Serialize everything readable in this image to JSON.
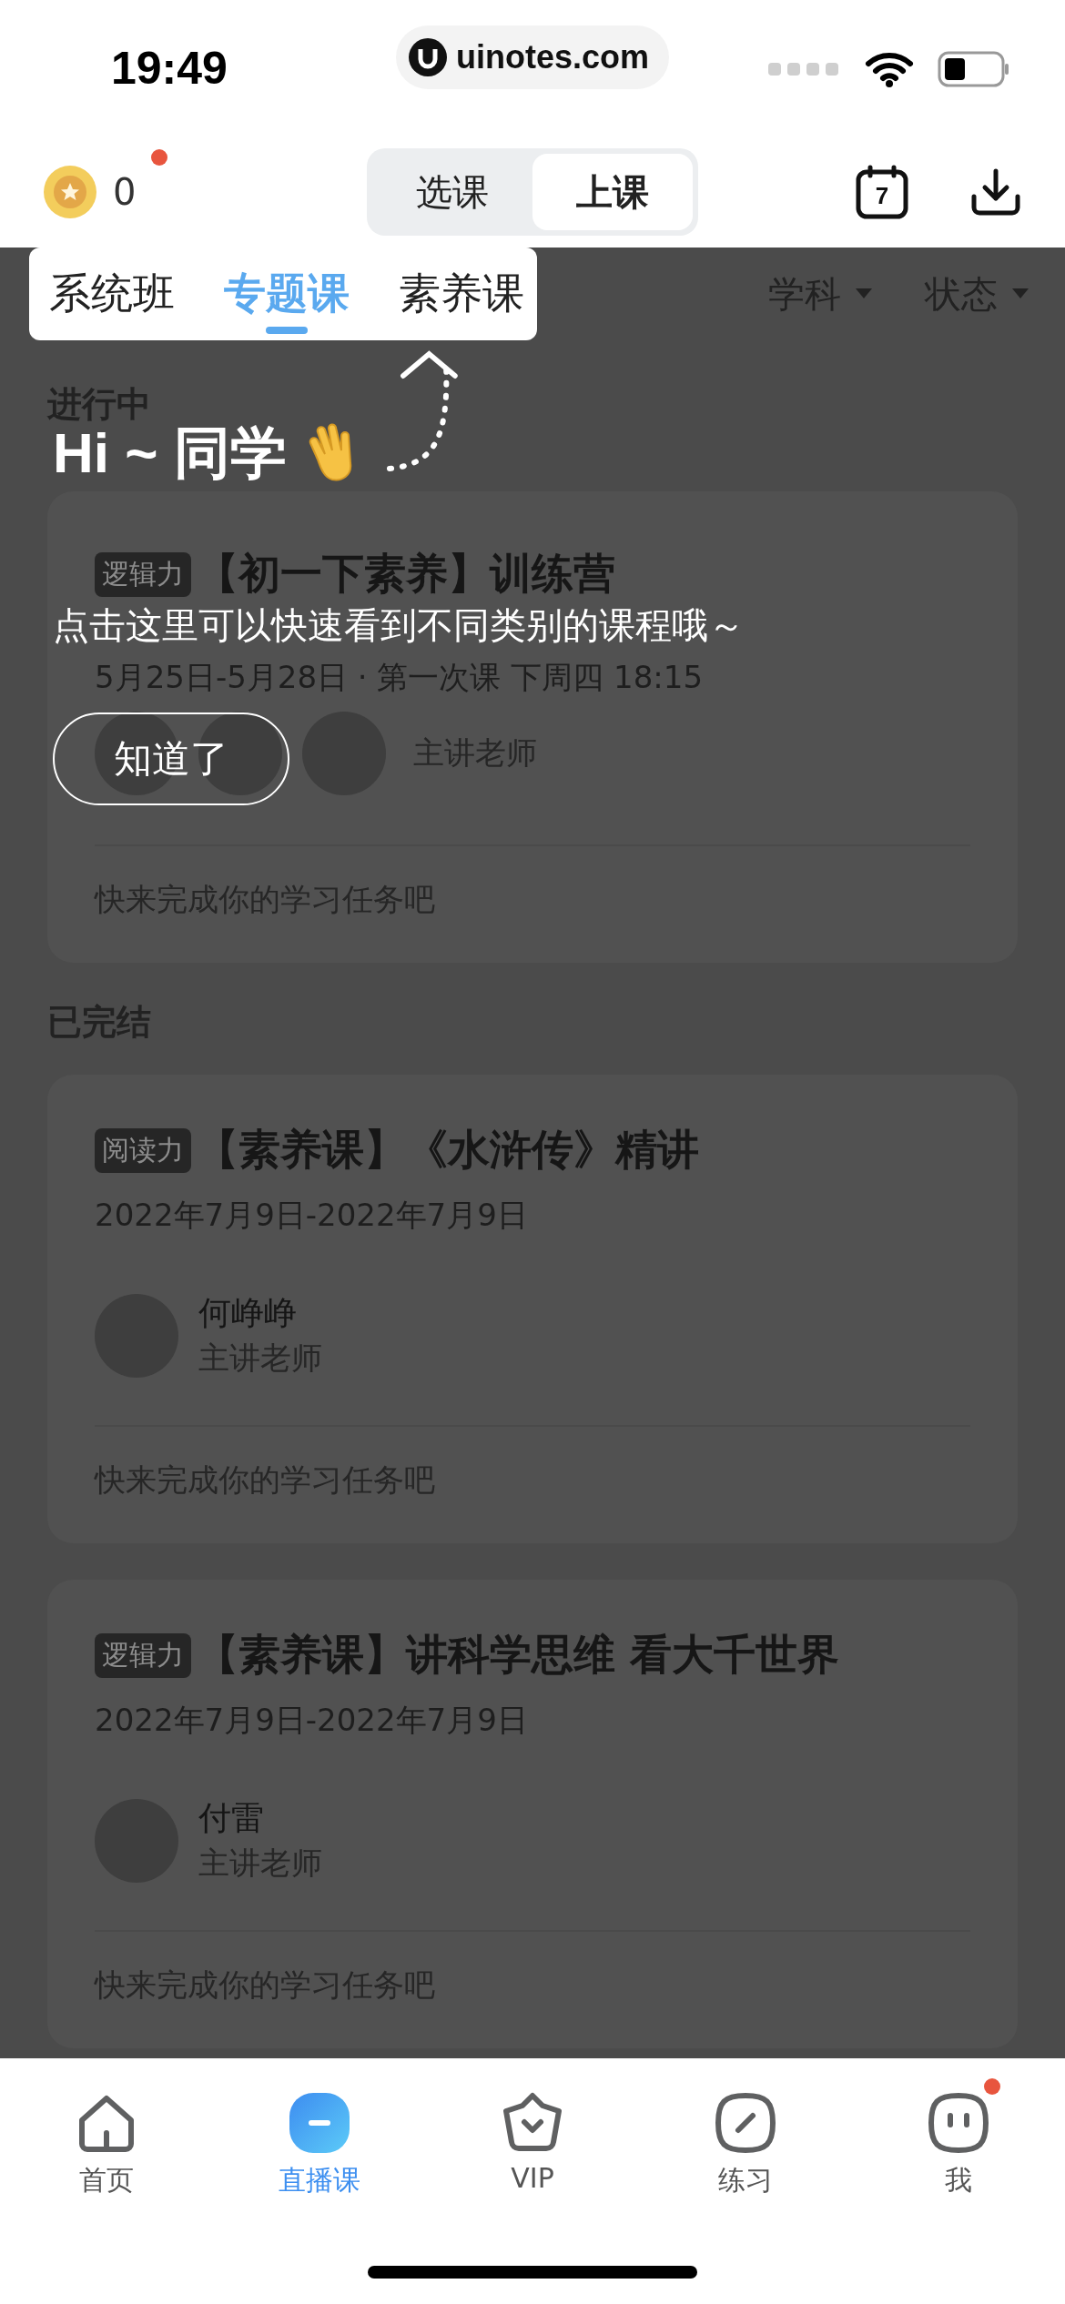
{
  "status_bar": {
    "time": "19:49",
    "url": "uinotes.com"
  },
  "header": {
    "coins": "0",
    "coin_badge": true,
    "segments": [
      {
        "label": "选课",
        "selected": false
      },
      {
        "label": "上课",
        "selected": true
      }
    ],
    "calendar_day": "7"
  },
  "category_tabs": [
    {
      "label": "系统班",
      "selected": false
    },
    {
      "label": "专题课",
      "selected": true
    },
    {
      "label": "素养课",
      "selected": false
    }
  ],
  "filters": [
    {
      "label": "学科"
    },
    {
      "label": "状态"
    }
  ],
  "sections": [
    {
      "title": "进行中",
      "courses": [
        {
          "tag": "逻辑力",
          "title": "【初一下素养】训练营",
          "date": "5月25日-5月28日 · 第一次课 下周四 18:15",
          "teachers": [
            {
              "kind": "photo"
            },
            {
              "kind": "photo"
            },
            {
              "kind": "photo"
            }
          ],
          "role": "主讲老师",
          "footer": "快来完成你的学习任务吧"
        }
      ]
    },
    {
      "title": "已完结",
      "courses": [
        {
          "tag": "阅读力",
          "title": "【素养课】《水浒传》精讲",
          "date": "2022年7月9日-2022年7月9日",
          "teachers": [
            {
              "kind": "photo",
              "name": "何峥峥"
            }
          ],
          "role": "主讲老师",
          "footer": "快来完成你的学习任务吧"
        },
        {
          "tag": "逻辑力",
          "title": "【素养课】讲科学思维 看大千世界",
          "date": "2022年7月9日-2022年7月9日",
          "teachers": [
            {
              "kind": "photo",
              "name": "付雷"
            }
          ],
          "role": "主讲老师",
          "footer": "快来完成你的学习任务吧"
        }
      ]
    }
  ],
  "coach": {
    "greeting": "Hi ~ 同学",
    "message": "点击这里可以快速看到不同类别的课程哦～",
    "button": "知道了"
  },
  "tab_bar": [
    {
      "kind": "home",
      "label": "首页",
      "selected": false,
      "badge": false
    },
    {
      "kind": "live",
      "label": "直播课",
      "selected": true,
      "badge": false
    },
    {
      "kind": "vip",
      "label": "VIP",
      "selected": false,
      "badge": false
    },
    {
      "kind": "practice",
      "label": "练习",
      "selected": false,
      "badge": false
    },
    {
      "kind": "me",
      "label": "我",
      "selected": false,
      "badge": true
    }
  ]
}
